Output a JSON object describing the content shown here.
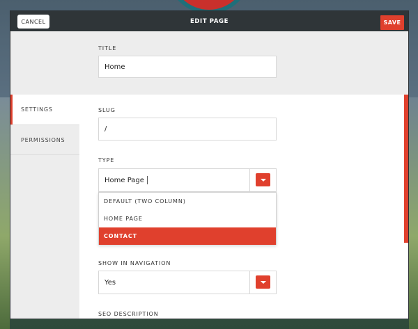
{
  "header": {
    "cancel_label": "CANCEL",
    "title": "EDIT PAGE",
    "save_label": "SAVE"
  },
  "sidebar": {
    "tabs": [
      {
        "label": "SETTINGS",
        "active": true
      },
      {
        "label": "PERMISSIONS",
        "active": false
      }
    ]
  },
  "form": {
    "title": {
      "label": "TITLE",
      "value": "Home"
    },
    "slug": {
      "label": "SLUG",
      "value": "/"
    },
    "type": {
      "label": "TYPE",
      "value": "Home Page",
      "options": [
        "DEFAULT (TWO COLUMN)",
        "HOME PAGE",
        "CONTACT"
      ],
      "highlighted": "CONTACT"
    },
    "show_in_navigation": {
      "label": "SHOW IN NAVIGATION",
      "value": "Yes"
    },
    "seo_description": {
      "label": "SEO DESCRIPTION"
    }
  },
  "colors": {
    "accent": "#e0402d",
    "topbar": "#2f3538",
    "panel": "#ededed"
  }
}
